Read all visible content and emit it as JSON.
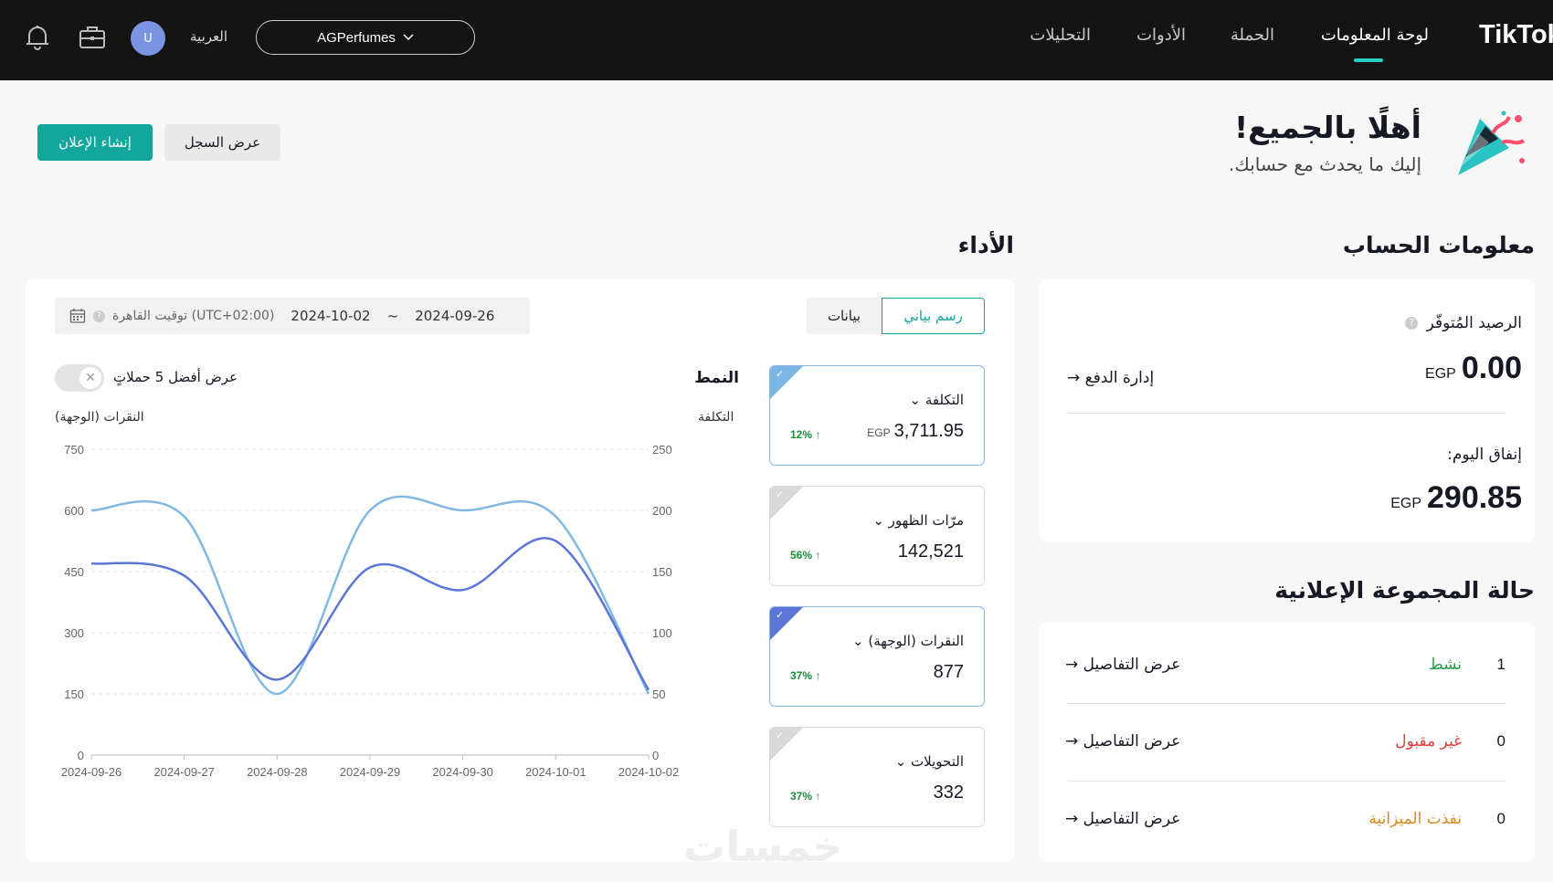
{
  "nav": {
    "logo": "TikTok",
    "items": [
      "لوحة المعلومات",
      "الحملة",
      "الأدوات",
      "التحليلات"
    ],
    "account_name": "AGPerfumes",
    "language": "العربية",
    "avatar_initial": "U"
  },
  "welcome": {
    "title": "أهلًا بالجميع!",
    "subtitle": "إليك ما يحدث مع حسابك.",
    "create_ad": "إنشاء الإعلان",
    "view_history": "عرض السجل"
  },
  "account_info": {
    "title": "معلومات الحساب",
    "balance_label": "الرصيد المُتوفّر",
    "balance_value": "0.00",
    "currency": "EGP",
    "manage_payment": "إدارة الدفع",
    "today_spend_label": "إنفاق اليوم:",
    "today_spend_value": "290.85"
  },
  "adgroup_status": {
    "title": "حالة المجموعة الإعلانية",
    "rows": [
      {
        "count": "1",
        "name": "نشط",
        "color": "#2a9d4b",
        "link": "عرض التفاصيل"
      },
      {
        "count": "0",
        "name": "غير مقبول",
        "color": "#e23b3b",
        "link": "عرض التفاصيل"
      },
      {
        "count": "0",
        "name": "نفذت الميزانية",
        "color": "#d98a1f",
        "link": "عرض التفاصيل"
      }
    ]
  },
  "performance": {
    "title": "الأداء",
    "tab_chart": "رسم بياني",
    "tab_data": "بيانات",
    "date_start": "2024-09-26",
    "date_sep": "~",
    "date_end": "2024-10-02",
    "timezone": "(UTC+02:00) توقيت القاهرة",
    "mode_label": "النمط",
    "top5_label": "عرض أفضل 5 حملاتٍ",
    "metrics": [
      {
        "label": "التكلفة",
        "currency": "EGP",
        "value": "3,711.95",
        "change": "12%",
        "selected": true,
        "corner_color": "#7ab6e6"
      },
      {
        "label": "مرّات الظهور",
        "currency": "",
        "value": "142,521",
        "change": "56%",
        "selected": false,
        "corner_color": "#d9d9d9"
      },
      {
        "label": "النقرات (الوجهة)",
        "currency": "",
        "value": "877",
        "change": "37%",
        "selected": true,
        "corner_color": "#5b76d6"
      },
      {
        "label": "التحويلات",
        "currency": "",
        "value": "332",
        "change": "37%",
        "selected": false,
        "corner_color": "#d9d9d9"
      }
    ]
  },
  "chart_data": {
    "type": "line",
    "x": [
      "2024-09-26",
      "2024-09-27",
      "2024-09-28",
      "2024-09-29",
      "2024-09-30",
      "2024-10-01",
      "2024-10-02"
    ],
    "left_axis_label": "النقرات (الوجهة)",
    "right_axis_label": "التكلفة",
    "left_ylim": [
      0,
      750
    ],
    "left_ticks": [
      0,
      150,
      300,
      450,
      600,
      750
    ],
    "right_ylim": [
      0,
      250
    ],
    "right_ticks": [
      0,
      50,
      100,
      150,
      200,
      250
    ],
    "series": [
      {
        "name": "التكلفة",
        "axis": "right",
        "color": "#82b9e3",
        "values": [
          200,
          195,
          50,
          200,
          200,
          195,
          50
        ]
      },
      {
        "name": "النقرات (الوجهة)",
        "axis": "left",
        "color": "#5b76d6",
        "values": [
          470,
          440,
          185,
          460,
          405,
          525,
          160
        ]
      }
    ]
  },
  "watermark": "خمسات"
}
